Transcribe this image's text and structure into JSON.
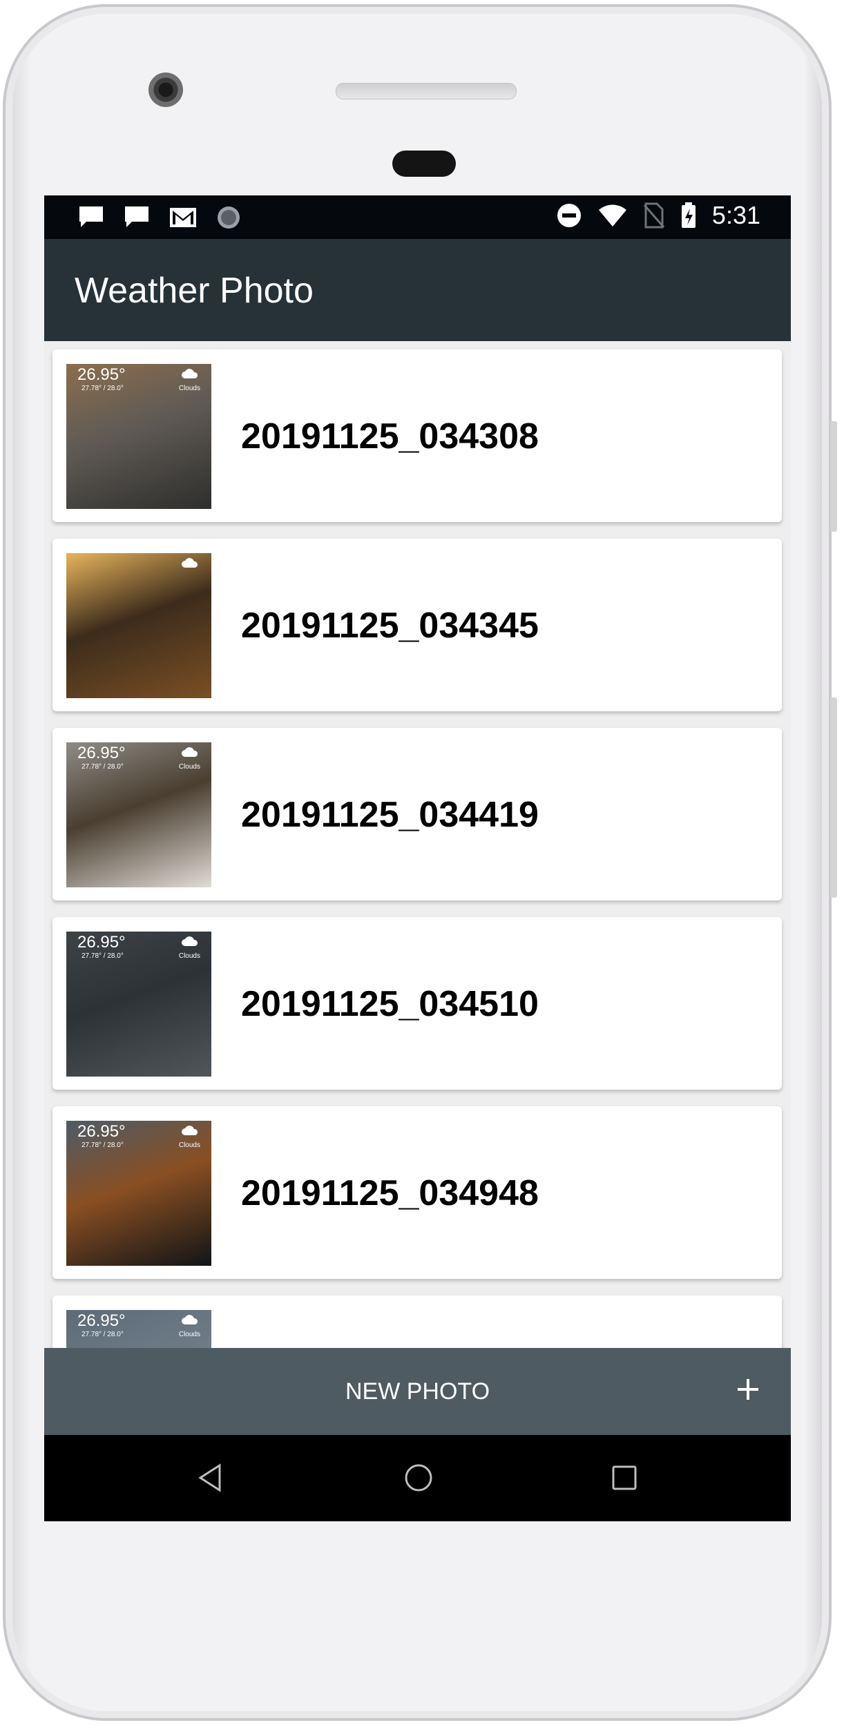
{
  "status_bar": {
    "time": "5:31",
    "left_icons": [
      "chat-bubble-icon",
      "chat-bubble-icon",
      "gmail-icon",
      "sync-icon"
    ],
    "right_icons": [
      "do-not-disturb-icon",
      "wifi-icon",
      "no-sim-icon",
      "battery-charging-icon"
    ]
  },
  "app_bar": {
    "title": "Weather Photo"
  },
  "photos": [
    {
      "title": "20191125_034308",
      "temp": "26.95°",
      "range": "27.78° / 28.0°",
      "condition": "Clouds",
      "weather_icon": "cloud-icon",
      "palette": [
        "#8b6e4e",
        "#2e2e2c",
        "#5f5a55"
      ]
    },
    {
      "title": "20191125_034345",
      "temp": "",
      "range": "",
      "condition": "",
      "weather_icon": "cloud-icon",
      "palette": [
        "#e8b45c",
        "#7a4f24",
        "#3c2c1c"
      ]
    },
    {
      "title": "20191125_034419",
      "temp": "26.95°",
      "range": "27.78° / 28.0°",
      "condition": "Clouds",
      "weather_icon": "cloud-icon",
      "palette": [
        "#8f8c86",
        "#e0dcd6",
        "#4a3e30"
      ]
    },
    {
      "title": "20191125_034510",
      "temp": "26.95°",
      "range": "27.78° / 28.0°",
      "condition": "Clouds",
      "weather_icon": "cloud-icon",
      "palette": [
        "#3e4347",
        "#50565a",
        "#2d3236"
      ]
    },
    {
      "title": "20191125_034948",
      "temp": "26.95°",
      "range": "27.78° / 28.0°",
      "condition": "Clouds",
      "weather_icon": "cloud-icon",
      "palette": [
        "#4d5b66",
        "#111417",
        "#8a4f22"
      ]
    },
    {
      "title": "",
      "temp": "26.95°",
      "range": "27.78° / 28.0°",
      "condition": "Clouds",
      "weather_icon": "cloud-icon",
      "palette": [
        "#5d6b78",
        "#4b5866",
        "#6f7c88"
      ]
    }
  ],
  "new_photo_button": {
    "label": "NEW PHOTO",
    "icon": "plus-icon"
  },
  "nav_bar": {
    "items": [
      "back-icon",
      "home-icon",
      "recents-icon"
    ]
  },
  "colors": {
    "app_bar": "#263238",
    "button_bar": "#4e5b62",
    "status_bar": "#05080d",
    "list_background": "#eeeeee"
  }
}
